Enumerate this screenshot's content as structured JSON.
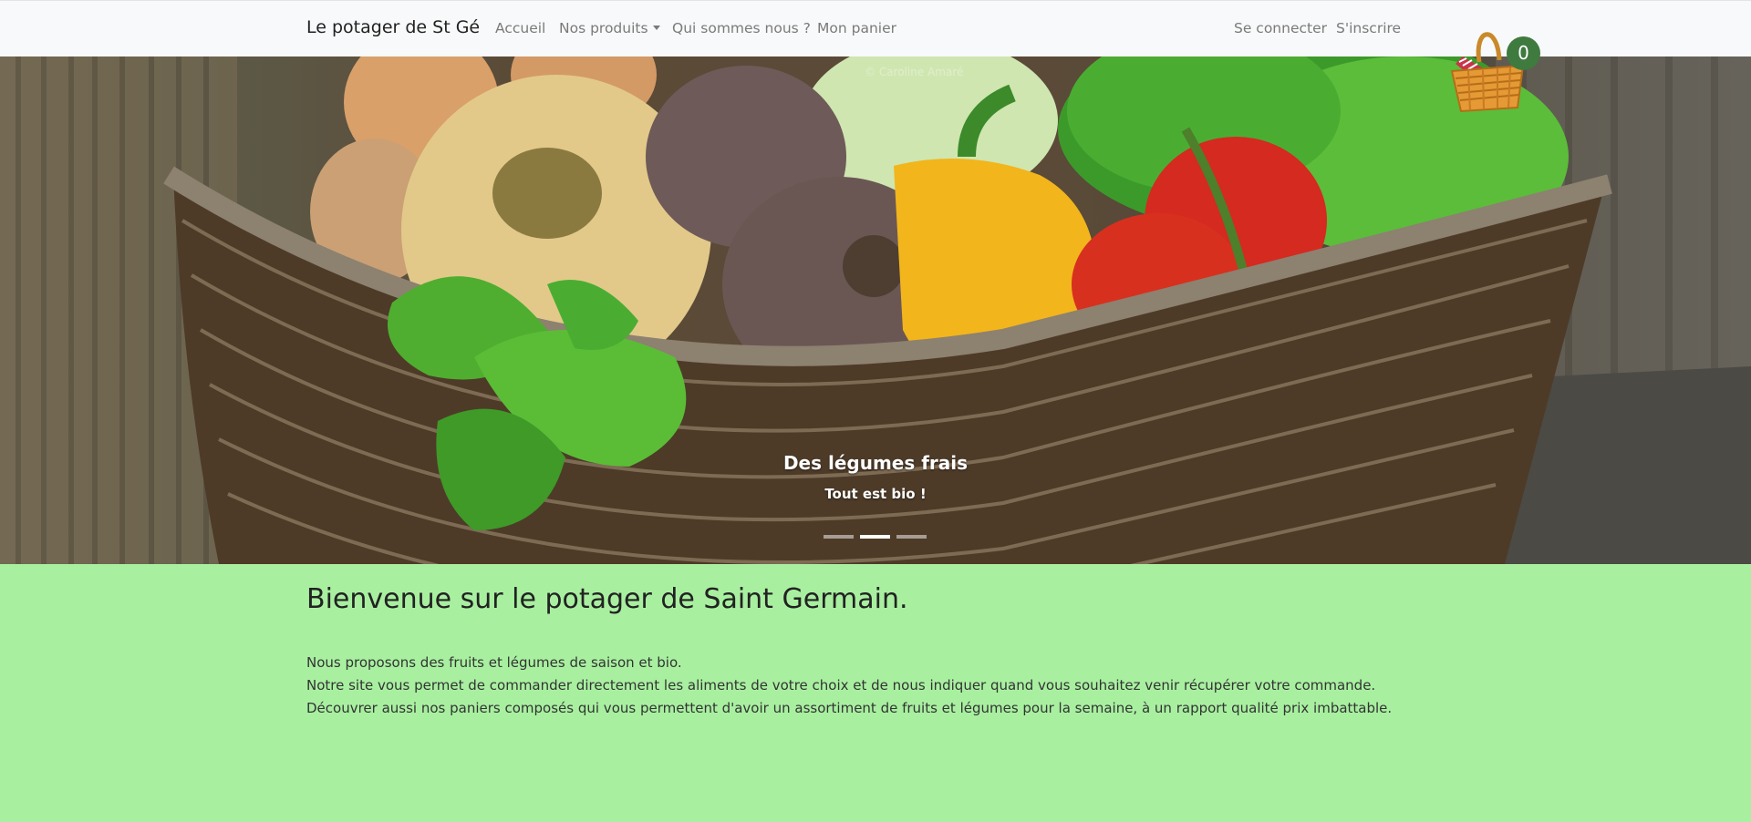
{
  "navbar": {
    "brand": "Le potager de St Gé",
    "links": [
      {
        "label": "Accueil"
      },
      {
        "label": "Nos produits"
      },
      {
        "label": "Qui sommes nous ?"
      },
      {
        "label": "Mon panier"
      }
    ],
    "right_links": [
      {
        "label": "Se connecter"
      },
      {
        "label": "S'inscrire"
      }
    ],
    "cart": {
      "count": "0",
      "icon": "basket-icon"
    }
  },
  "carousel": {
    "credit": "© Caroline Amaré",
    "title": "Des légumes frais",
    "subtitle": "Tout est bio !",
    "slides": 3,
    "active_index": 1
  },
  "main": {
    "heading": "Bienvenue sur le potager de Saint Germain.",
    "paragraphs": [
      "Nous proposons des fruits et légumes de saison et bio.",
      "Notre site vous permet de commander directement les aliments de votre choix et de nous indiquer quand vous souhaitez venir récupérer votre commande.",
      "Découvrer aussi nos paniers composés qui vous permettent d'avoir un assortiment de fruits et légumes pour la semaine, à un rapport qualité prix imbattable."
    ]
  },
  "colors": {
    "page_bg": "#a8f0a0",
    "navbar_bg": "#f8f9fa",
    "badge": "#3f7a3f"
  }
}
